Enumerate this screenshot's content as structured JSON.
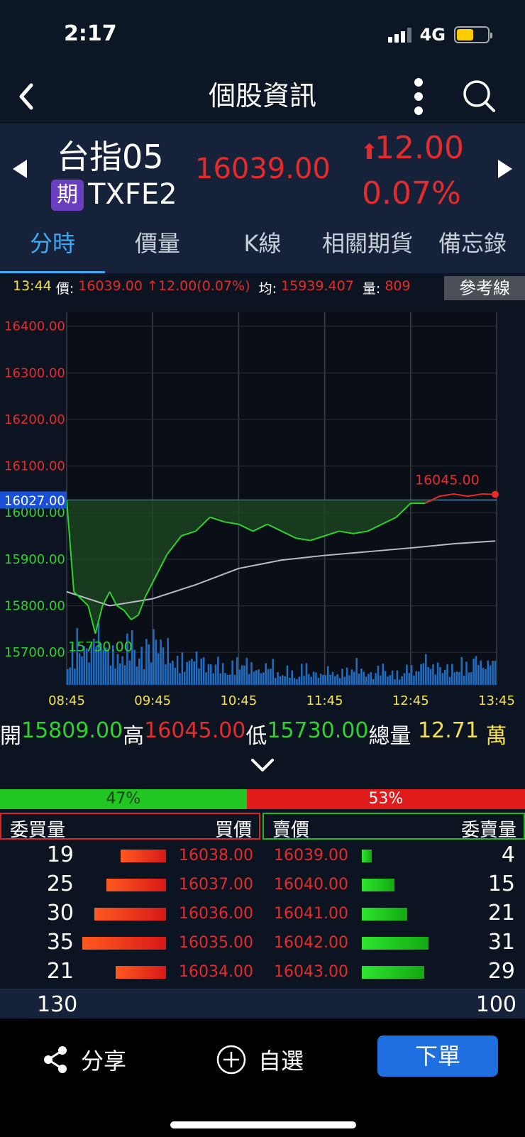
{
  "status_bar": {
    "time": "2:17",
    "network": "4G"
  },
  "nav": {
    "title": "個股資訊"
  },
  "header": {
    "name": "台指05",
    "badge": "期",
    "code": "TXFE2",
    "price": "16039.00",
    "change_arrow": "⬆",
    "change": "12.00",
    "change_pct": "0.07%"
  },
  "tabs": [
    "分時",
    "價量",
    "K線",
    "相關期貨",
    "備忘錄"
  ],
  "active_tab": 0,
  "info": {
    "time": "13:44",
    "price_label": "價:",
    "price": "16039.00",
    "change": "↑12.00(0.07%)",
    "avg_label": "均:",
    "avg": "15939.407",
    "vol_label": "量:",
    "vol": "809",
    "ref_button": "參考線"
  },
  "chart_data": {
    "type": "line",
    "y_ticks": [
      "16400.00",
      "16300.00",
      "16200.00",
      "16100.00",
      "16000.00",
      "15900.00",
      "15800.00",
      "15700.00"
    ],
    "x_ticks": [
      "08:45",
      "09:45",
      "10:45",
      "11:45",
      "12:45",
      "13:45"
    ],
    "ylim": [
      15630,
      16430
    ],
    "reference_price": "16027.00",
    "high_label": "16045.00",
    "low_label": "15730.00",
    "price_series": {
      "x": [
        "08:45",
        "08:50",
        "09:00",
        "09:05",
        "09:10",
        "09:15",
        "09:20",
        "09:25",
        "09:30",
        "09:35",
        "09:40",
        "09:45",
        "09:55",
        "10:05",
        "10:15",
        "10:25",
        "10:35",
        "10:45",
        "10:55",
        "11:05",
        "11:15",
        "11:25",
        "11:35",
        "11:45",
        "11:55",
        "12:05",
        "12:15",
        "12:25",
        "12:35",
        "12:45",
        "12:55",
        "13:05",
        "13:15",
        "13:25",
        "13:35",
        "13:44"
      ],
      "values": [
        16027,
        15830,
        15800,
        15740,
        15800,
        15830,
        15800,
        15790,
        15770,
        15780,
        15820,
        15850,
        15910,
        15950,
        15960,
        15990,
        15980,
        15975,
        15960,
        15975,
        15960,
        15945,
        15940,
        15950,
        15960,
        15955,
        15960,
        15975,
        15990,
        16020,
        16020,
        16035,
        16040,
        16035,
        16040,
        16039
      ]
    },
    "avg_series": {
      "x": [
        "08:45",
        "09:15",
        "09:45",
        "10:15",
        "10:45",
        "11:15",
        "11:45",
        "12:15",
        "12:45",
        "13:15",
        "13:44"
      ],
      "values": [
        15830,
        15800,
        15815,
        15845,
        15880,
        15898,
        15908,
        15916,
        15924,
        15933,
        15939
      ]
    },
    "volume_series": {
      "note_unit": "relative",
      "values": [
        0.55,
        0.75,
        0.6,
        0.9,
        0.7,
        0.5,
        0.65,
        0.8,
        0.55,
        0.7,
        0.85,
        0.6,
        0.5,
        0.4,
        0.55,
        0.45,
        0.35,
        0.4,
        0.3,
        0.35,
        0.45,
        0.3,
        0.25,
        0.35,
        0.2,
        0.25,
        0.2,
        0.3,
        0.22,
        0.18,
        0.25,
        0.2,
        0.28,
        0.35,
        0.25,
        0.2,
        0.3,
        0.22,
        0.18,
        0.35,
        0.25,
        0.45,
        0.3,
        0.35,
        0.28,
        0.4,
        0.3,
        0.5,
        0.35,
        0.45
      ]
    }
  },
  "ohlc": {
    "open_label": "開",
    "open": "15809.00",
    "high_label": "高",
    "high": "16045.00",
    "low_label": "低",
    "low": "15730.00",
    "total_label": "總量",
    "total": "12.71",
    "total_unit": "萬"
  },
  "ratio": {
    "buy_pct": "47%",
    "sell_pct": "53%",
    "buy_frac": 0.47
  },
  "orderbook_header": {
    "buy_qty": "委買量",
    "buy_price": "買價",
    "sell_price": "賣價",
    "sell_qty": "委賣量"
  },
  "orderbook": [
    {
      "bqty": "19",
      "bprice": "16038.00",
      "sprice": "16039.00",
      "sqty": "4",
      "bw": 0.54,
      "sw": 0.11
    },
    {
      "bqty": "25",
      "bprice": "16037.00",
      "sprice": "16040.00",
      "sqty": "15",
      "bw": 0.71,
      "sw": 0.43
    },
    {
      "bqty": "30",
      "bprice": "16036.00",
      "sprice": "16041.00",
      "sqty": "21",
      "bw": 0.86,
      "sw": 0.6
    },
    {
      "bqty": "35",
      "bprice": "16035.00",
      "sprice": "16042.00",
      "sqty": "31",
      "bw": 1.0,
      "sw": 0.89
    },
    {
      "bqty": "21",
      "bprice": "16034.00",
      "sprice": "16043.00",
      "sqty": "29",
      "bw": 0.6,
      "sw": 0.83
    }
  ],
  "totals": {
    "buy": "130",
    "sell": "100"
  },
  "bottom": {
    "share": "分享",
    "watch": "自選",
    "order": "下單"
  },
  "colors": {
    "up": "#e62b2b",
    "down": "#2cd32c",
    "accent": "#3fa9f5",
    "order_button": "#1f6fe0"
  }
}
